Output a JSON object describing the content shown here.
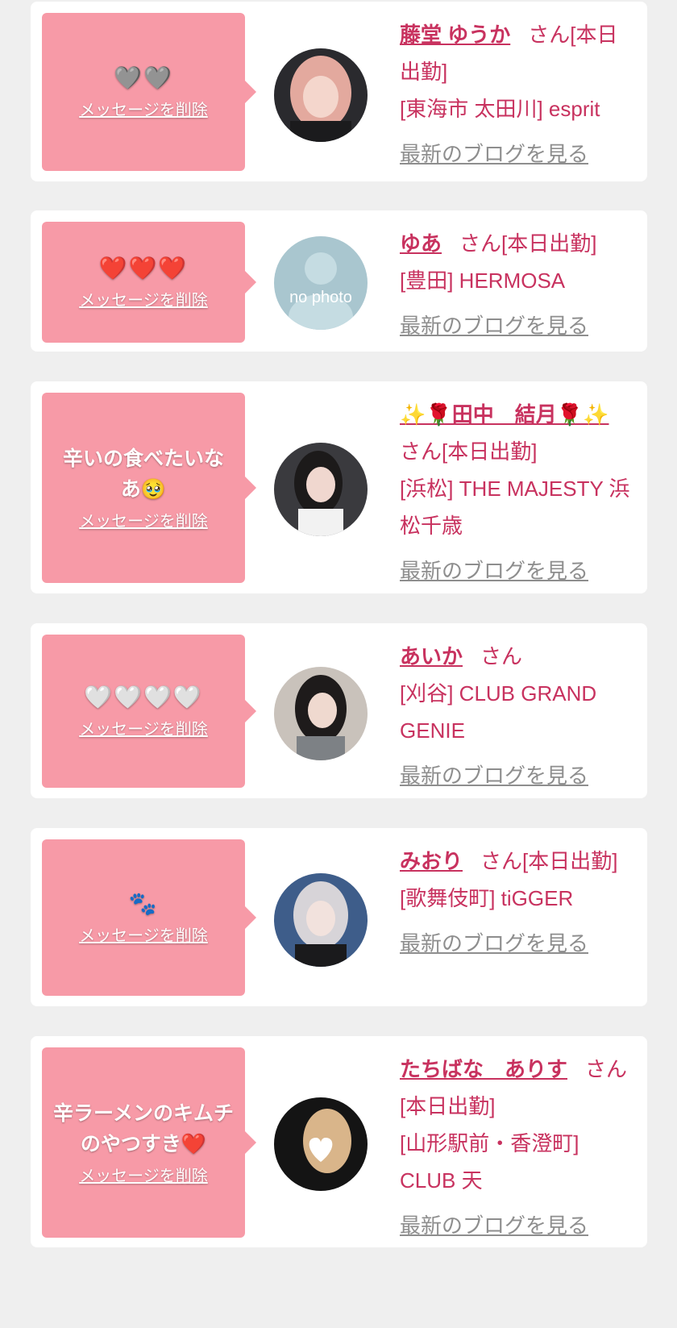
{
  "colors": {
    "bubble": "#f79aa7",
    "accent": "#c8325f",
    "link_gray": "#8e8e8e",
    "background": "#efefef"
  },
  "delete_label": "メッセージを削除",
  "blog_label": "最新のブログを見る",
  "cards": [
    {
      "message": "🩶🩶",
      "name": "藤堂 ゆうか",
      "suffix": "さん[本日出勤]",
      "store": "[東海市 太田川] esprit",
      "avatar": "photo-pink-hair"
    },
    {
      "message": "❤️❤️❤️",
      "name": "ゆあ",
      "suffix": "さん[本日出勤]",
      "store": "[豊田] HERMOSA",
      "avatar": "no-photo",
      "avatar_text": "no photo"
    },
    {
      "message": "辛いの食べたいなあ🥹",
      "name": "✨🌹田中　結月🌹✨",
      "suffix": "さん[本日出勤]",
      "store": "[浜松] THE MAJESTY 浜松千歳",
      "avatar": "photo-dark-hair"
    },
    {
      "message": "🤍🤍🤍🤍",
      "name": "あいか",
      "suffix": "さん",
      "store": "[刈谷] CLUB GRAND GENIE",
      "avatar": "photo-black-hair"
    },
    {
      "message": "🐾",
      "name": "みおり",
      "suffix": "さん[本日出勤]",
      "store": "[歌舞伎町] tiGGER",
      "avatar": "photo-silver-hair"
    },
    {
      "message": "辛ラーメンのキムチのやつすき❤️",
      "name": "たちばな　ありす",
      "suffix": "さん[本日出勤]",
      "store": "[山形駅前・香澄町] CLUB 天",
      "avatar": "photo-heart-cover"
    }
  ]
}
